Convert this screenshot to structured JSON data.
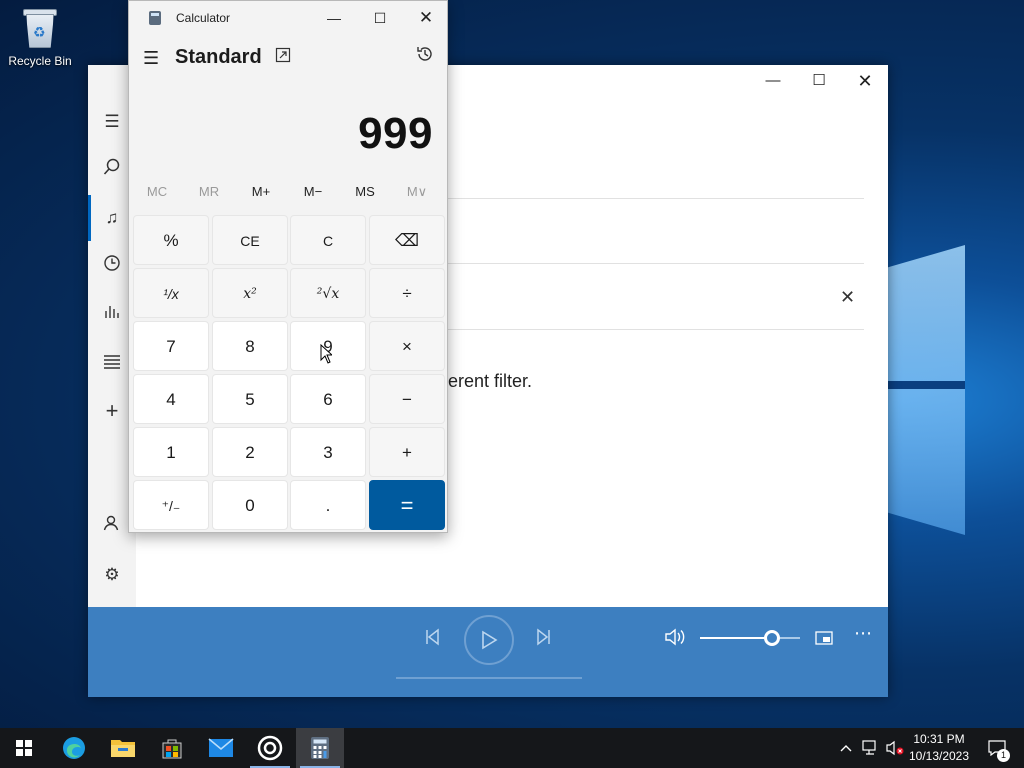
{
  "desktop": {
    "recycle_bin_label": "Recycle Bin"
  },
  "media_player": {
    "empty_message": "erent filter.",
    "nav_icons": [
      "hamburger-icon",
      "search-icon",
      "music-note-icon",
      "clock-icon",
      "chart-icon",
      "playlist-icon",
      "add-icon",
      "account-icon",
      "gear-icon"
    ],
    "window_controls": [
      "minimize",
      "maximize",
      "close"
    ],
    "playback": {
      "volume_level": 0.72,
      "controls": [
        "previous",
        "play",
        "next",
        "volume",
        "mini-player",
        "more"
      ]
    }
  },
  "calculator": {
    "title": "Calculator",
    "mode": "Standard",
    "display": "999",
    "memory": [
      {
        "label": "MC",
        "enabled": false
      },
      {
        "label": "MR",
        "enabled": false
      },
      {
        "label": "M+",
        "enabled": true
      },
      {
        "label": "M−",
        "enabled": true
      },
      {
        "label": "MS",
        "enabled": true
      },
      {
        "label": "M∨",
        "enabled": false
      }
    ],
    "keys": {
      "percent": "%",
      "ce": "CE",
      "c": "C",
      "backspace": "⌫",
      "reciprocal": "¹/x",
      "square": "x²",
      "sqrt": "²√x",
      "divide": "÷",
      "n7": "7",
      "n8": "8",
      "n9": "9",
      "multiply": "×",
      "n4": "4",
      "n5": "5",
      "n6": "6",
      "minus": "−",
      "n1": "1",
      "n2": "2",
      "n3": "3",
      "plus": "+",
      "negate": "⁺/₋",
      "n0": "0",
      "decimal": ".",
      "equals": "="
    }
  },
  "taskbar": {
    "apps": [
      "start",
      "edge",
      "file-explorer",
      "store",
      "mail",
      "media-player",
      "calculator"
    ],
    "active_app": "calculator",
    "time": "10:31 PM",
    "date": "10/13/2023",
    "notification_count": "1"
  }
}
